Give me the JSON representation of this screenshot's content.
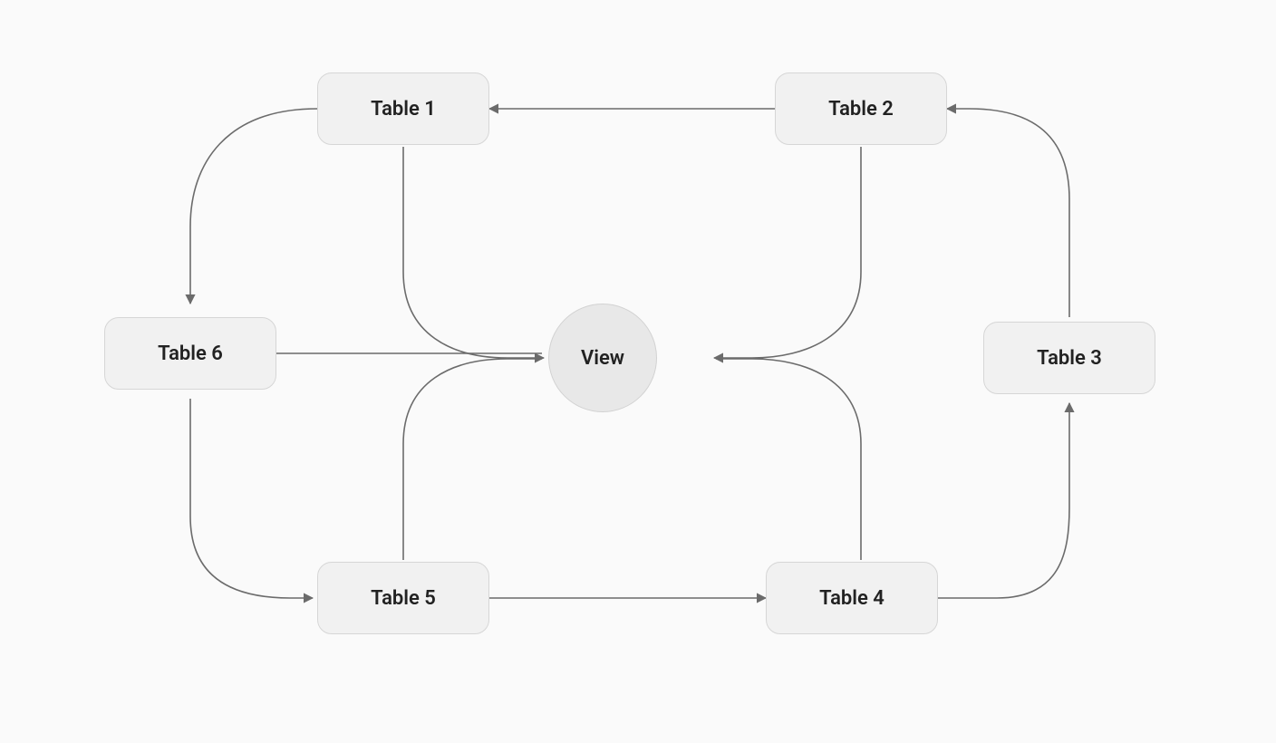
{
  "nodes": {
    "table1": {
      "label": "Table 1"
    },
    "table2": {
      "label": "Table 2"
    },
    "table3": {
      "label": "Table 3"
    },
    "table4": {
      "label": "Table 4"
    },
    "table5": {
      "label": "Table 5"
    },
    "table6": {
      "label": "Table 6"
    },
    "view": {
      "label": "View"
    }
  },
  "diagram": {
    "edges": [
      {
        "from": "table2",
        "to": "table1"
      },
      {
        "from": "table1",
        "to": "table6"
      },
      {
        "from": "table6",
        "to": "table5"
      },
      {
        "from": "table5",
        "to": "table4"
      },
      {
        "from": "table4",
        "to": "table3"
      },
      {
        "from": "table3",
        "to": "table2"
      },
      {
        "from": "table1",
        "to": "view"
      },
      {
        "from": "table2",
        "to": "view"
      },
      {
        "from": "table5",
        "to": "view"
      },
      {
        "from": "table4",
        "to": "view"
      },
      {
        "from": "table6",
        "to": "view"
      }
    ]
  }
}
